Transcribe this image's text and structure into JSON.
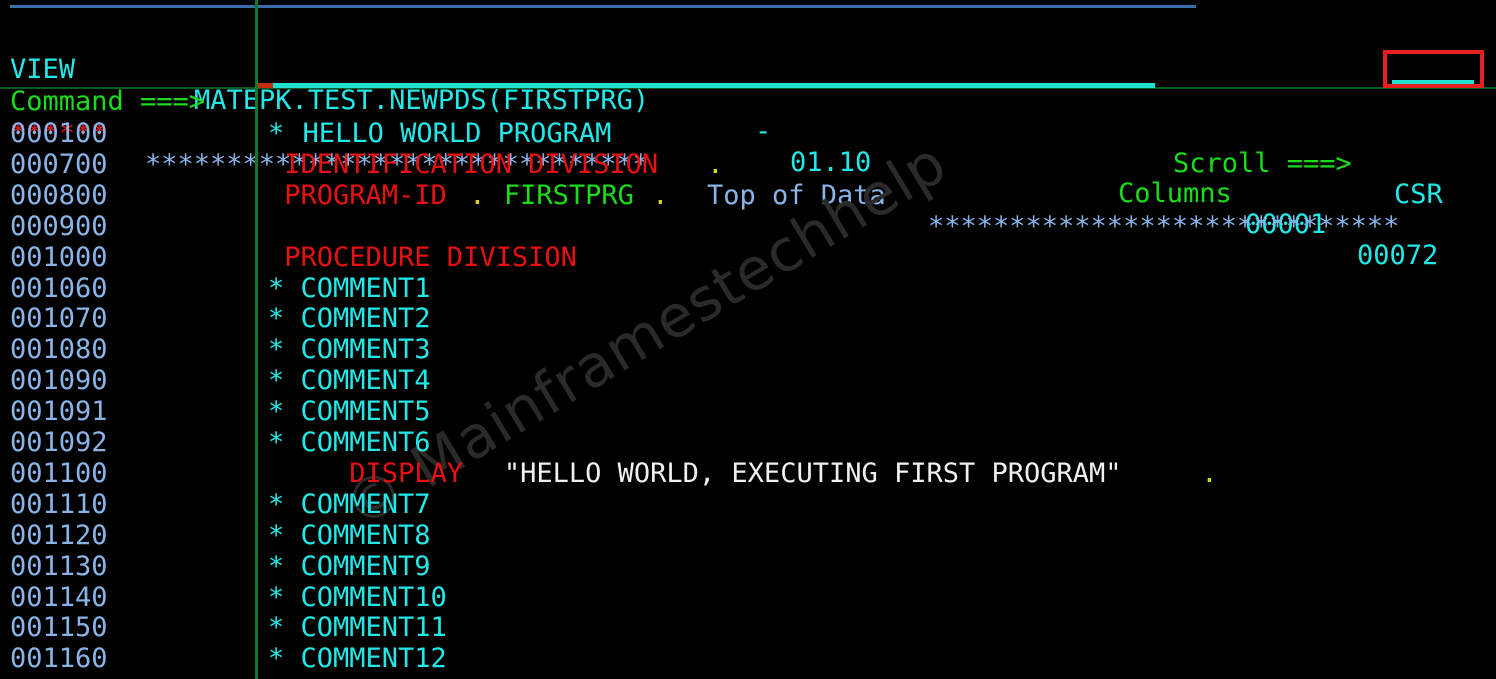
{
  "terminal": {
    "mode_label": "VIEW",
    "dataset": "MATEPK.TEST.NEWPDS(FIRSTPRG)",
    "dash": "-",
    "version": "01.10",
    "columns_label": "Columns",
    "columns_from": "00001",
    "columns_to": "00072",
    "command_label": "Command ===>",
    "command_value": "",
    "command_placeholder": "",
    "scroll_label": "Scroll ===>",
    "scroll_value": "CSR",
    "top_of_data_left_stars": "******",
    "top_of_data_stars_left": "*******************************",
    "top_of_data_text": "Top of Data",
    "top_of_data_stars_right": "*****************************"
  },
  "watermark": {
    "text": "© Mainframestechhelp"
  },
  "colors": {
    "background": "#000000",
    "cyan": "#22e8e8",
    "green": "#19dd19",
    "red": "#e81010",
    "light_blue": "#8ab4e8",
    "white": "#f0f0f0",
    "yellow": "#d8d81a",
    "divider_green": "#0c7a28",
    "highlight_red": "#e81f1f",
    "blue_rule": "#3b6ea8"
  },
  "lines": [
    {
      "num": "000100",
      "segments": [
        {
          "text": "*",
          "color": "c-cyan"
        },
        {
          "text": " HELLO WORLD PROGRAM",
          "color": "c-cyan"
        }
      ]
    },
    {
      "num": "000700",
      "segments": [
        {
          "text": " IDENTIFICATION DIVISION",
          "color": "c-red"
        },
        {
          "text": ".",
          "color": "c-yellow"
        }
      ]
    },
    {
      "num": "000800",
      "segments": [
        {
          "text": " PROGRAM-ID",
          "color": "c-red"
        },
        {
          "text": ".",
          "color": "c-yellow"
        },
        {
          "text": " FIRSTPRG",
          "color": "c-green"
        },
        {
          "text": ".",
          "color": "c-yellow"
        }
      ]
    },
    {
      "num": "000900",
      "segments": []
    },
    {
      "num": "001000",
      "segments": [
        {
          "text": " PROCEDURE DIVISION",
          "color": "c-red"
        }
      ]
    },
    {
      "num": "001060",
      "segments": [
        {
          "text": "* COMMENT1",
          "color": "c-cyan"
        }
      ]
    },
    {
      "num": "001070",
      "segments": [
        {
          "text": "* COMMENT2",
          "color": "c-cyan"
        }
      ]
    },
    {
      "num": "001080",
      "segments": [
        {
          "text": "* COMMENT3",
          "color": "c-cyan"
        }
      ]
    },
    {
      "num": "001090",
      "segments": [
        {
          "text": "* COMMENT4",
          "color": "c-cyan"
        }
      ]
    },
    {
      "num": "001091",
      "segments": [
        {
          "text": "* COMMENT5",
          "color": "c-cyan"
        }
      ]
    },
    {
      "num": "001092",
      "segments": [
        {
          "text": "* COMMENT6",
          "color": "c-cyan"
        }
      ]
    },
    {
      "num": "001100",
      "segments": [
        {
          "text": "     DISPLAY",
          "color": "c-red"
        },
        {
          "text": " \"HELLO WORLD, EXECUTING FIRST PROGRAM\"",
          "color": "c-white"
        },
        {
          "text": ".",
          "color": "c-yellow"
        }
      ]
    },
    {
      "num": "001110",
      "segments": [
        {
          "text": "* COMMENT7",
          "color": "c-cyan"
        }
      ]
    },
    {
      "num": "001120",
      "segments": [
        {
          "text": "* COMMENT8",
          "color": "c-cyan"
        }
      ]
    },
    {
      "num": "001130",
      "segments": [
        {
          "text": "* COMMENT9",
          "color": "c-cyan"
        }
      ]
    },
    {
      "num": "001140",
      "segments": [
        {
          "text": "* COMMENT10",
          "color": "c-cyan"
        }
      ]
    },
    {
      "num": "001150",
      "segments": [
        {
          "text": "* COMMENT11",
          "color": "c-cyan"
        }
      ]
    },
    {
      "num": "001160",
      "segments": [
        {
          "text": "* COMMENT12",
          "color": "c-cyan"
        }
      ]
    }
  ]
}
